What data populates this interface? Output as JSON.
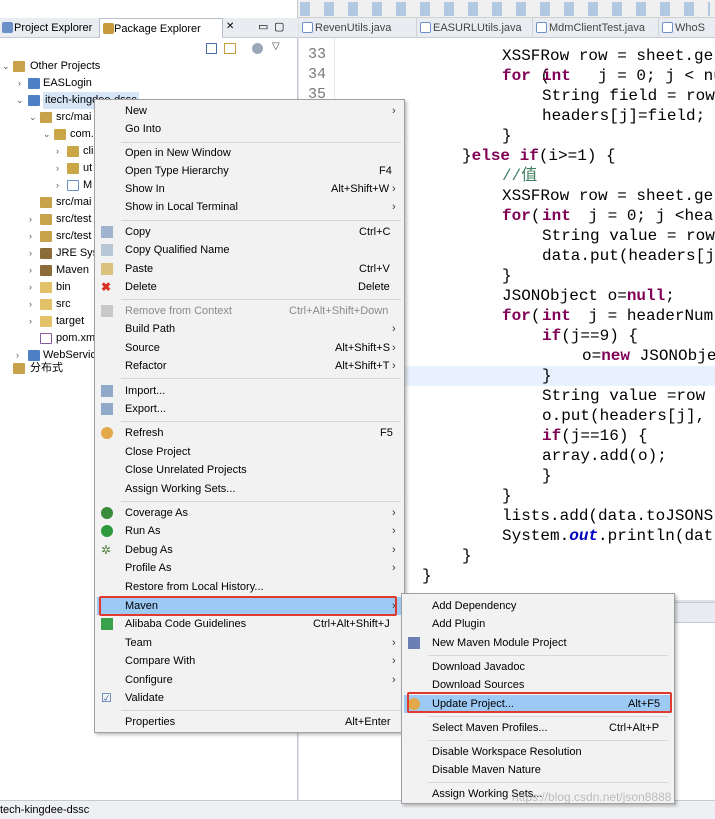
{
  "editor_tabs": [
    "RevenUtils.java",
    "EASURLUtils.java",
    "MdmClientTest.java",
    "WhoS"
  ],
  "views": {
    "project_explorer_tab": "Project Explorer",
    "package_explorer_tab": "Package Explorer"
  },
  "tree": [
    {
      "label": "Other Projects"
    },
    {
      "label": "EASLogin"
    },
    {
      "label": "itech-kingdee-dssc"
    },
    {
      "label": "src/mai"
    },
    {
      "label": "com."
    },
    {
      "label": "cli"
    },
    {
      "label": "ut"
    },
    {
      "label": "M"
    },
    {
      "label": "src/mai"
    },
    {
      "label": "src/test"
    },
    {
      "label": "src/test"
    },
    {
      "label": "JRE Sys"
    },
    {
      "label": "Maven"
    },
    {
      "label": "bin"
    },
    {
      "label": "src"
    },
    {
      "label": "target"
    },
    {
      "label": "pom.xm"
    },
    {
      "label": "WebServic"
    },
    {
      "label": "分布式"
    }
  ],
  "line_numbers": [
    "33",
    "34",
    "35"
  ],
  "code": {
    "l1": "XSSFRow row = sheet.ge",
    "l2_kw1": "for",
    "l2_kw2": "int",
    "l2": " (     j = 0; j < nu",
    "l3": "String field = row",
    "l4": "headers[j]=field;",
    "l5": "}",
    "l6a": "}",
    "l6_kw": "else if",
    "l6b": "(i>=1) {",
    "l7": "//值",
    "l8": "XSSFRow row = sheet.ge",
    "l9a": "(     j = 0; j <hea",
    "l10": "String value = row",
    "l11": "data.put(headers[j",
    "l12": "}",
    "l13a": "JSONObject o=",
    "l13_kw": "null",
    "l13b": ";",
    "l14a": "(     j = headerNum",
    "l15_kw": "if",
    "l15a": "(j==9) {",
    "l16_kw": "new",
    "l16a": "o=",
    "l16b": " JSONObje",
    "l17": "}",
    "l18": "String value =row",
    "l19": "o.put(headers[j],",
    "l20a": "(j==16) {",
    "l21": "array.add(o);",
    "l22": "}",
    "l23": "}",
    "l24": "lists.add(data.toJSONS",
    "l25a": "System.",
    "l25_fld": "out",
    "l25b": ".println(dat",
    "l26": "}",
    "l27": "}"
  },
  "context_menu": [
    {
      "label": "New",
      "arrow": true
    },
    {
      "label": "Go Into"
    },
    {
      "label": "Open in New Window"
    },
    {
      "label": "Open Type Hierarchy",
      "accel": "F4"
    },
    {
      "label": "Show In",
      "accel": "Alt+Shift+W",
      "arrow": true
    },
    {
      "label": "Show in Local Terminal",
      "arrow": true
    },
    {
      "label": "Copy",
      "accel": "Ctrl+C"
    },
    {
      "label": "Copy Qualified Name"
    },
    {
      "label": "Paste",
      "accel": "Ctrl+V"
    },
    {
      "label": "Delete",
      "accel": "Delete"
    },
    {
      "label": "Remove from Context",
      "accel": "Ctrl+Alt+Shift+Down",
      "disabled": true
    },
    {
      "label": "Build Path",
      "arrow": true
    },
    {
      "label": "Source",
      "accel": "Alt+Shift+S",
      "arrow": true
    },
    {
      "label": "Refactor",
      "accel": "Alt+Shift+T",
      "arrow": true
    },
    {
      "label": "Import..."
    },
    {
      "label": "Export..."
    },
    {
      "label": "Refresh",
      "accel": "F5"
    },
    {
      "label": "Close Project"
    },
    {
      "label": "Close Unrelated Projects"
    },
    {
      "label": "Assign Working Sets..."
    },
    {
      "label": "Coverage As",
      "arrow": true
    },
    {
      "label": "Run As",
      "arrow": true
    },
    {
      "label": "Debug As",
      "arrow": true
    },
    {
      "label": "Profile As",
      "arrow": true
    },
    {
      "label": "Restore from Local History..."
    },
    {
      "label": "Maven",
      "arrow": true,
      "highlighted": true
    },
    {
      "label": "Alibaba Code Guidelines",
      "accel": "Ctrl+Alt+Shift+J"
    },
    {
      "label": "Team",
      "arrow": true
    },
    {
      "label": "Compare With",
      "arrow": true
    },
    {
      "label": "Configure",
      "arrow": true
    },
    {
      "label": "Validate"
    },
    {
      "label": "Properties",
      "accel": "Alt+Enter"
    }
  ],
  "maven_submenu": [
    {
      "label": "Add Dependency"
    },
    {
      "label": "Add Plugin"
    },
    {
      "label": "New Maven Module Project"
    },
    {
      "label": "Download Javadoc"
    },
    {
      "label": "Download Sources"
    },
    {
      "label": "Update Project...",
      "accel": "Alt+F5",
      "highlighted": true
    },
    {
      "label": "Select Maven Profiles...",
      "accel": "Ctrl+Alt+P"
    },
    {
      "label": "Disable Workspace Resolution"
    },
    {
      "label": "Disable Maven Nature"
    },
    {
      "label": "Assign Working Sets..."
    }
  ],
  "status_text": "tech-kingdee-dssc",
  "watermark": "https://blog.csdn.net/json8888",
  "colors": {
    "highlight": "#9ccaf5",
    "annotation_red": "#e03a2f",
    "keyword": "#7f0055"
  }
}
